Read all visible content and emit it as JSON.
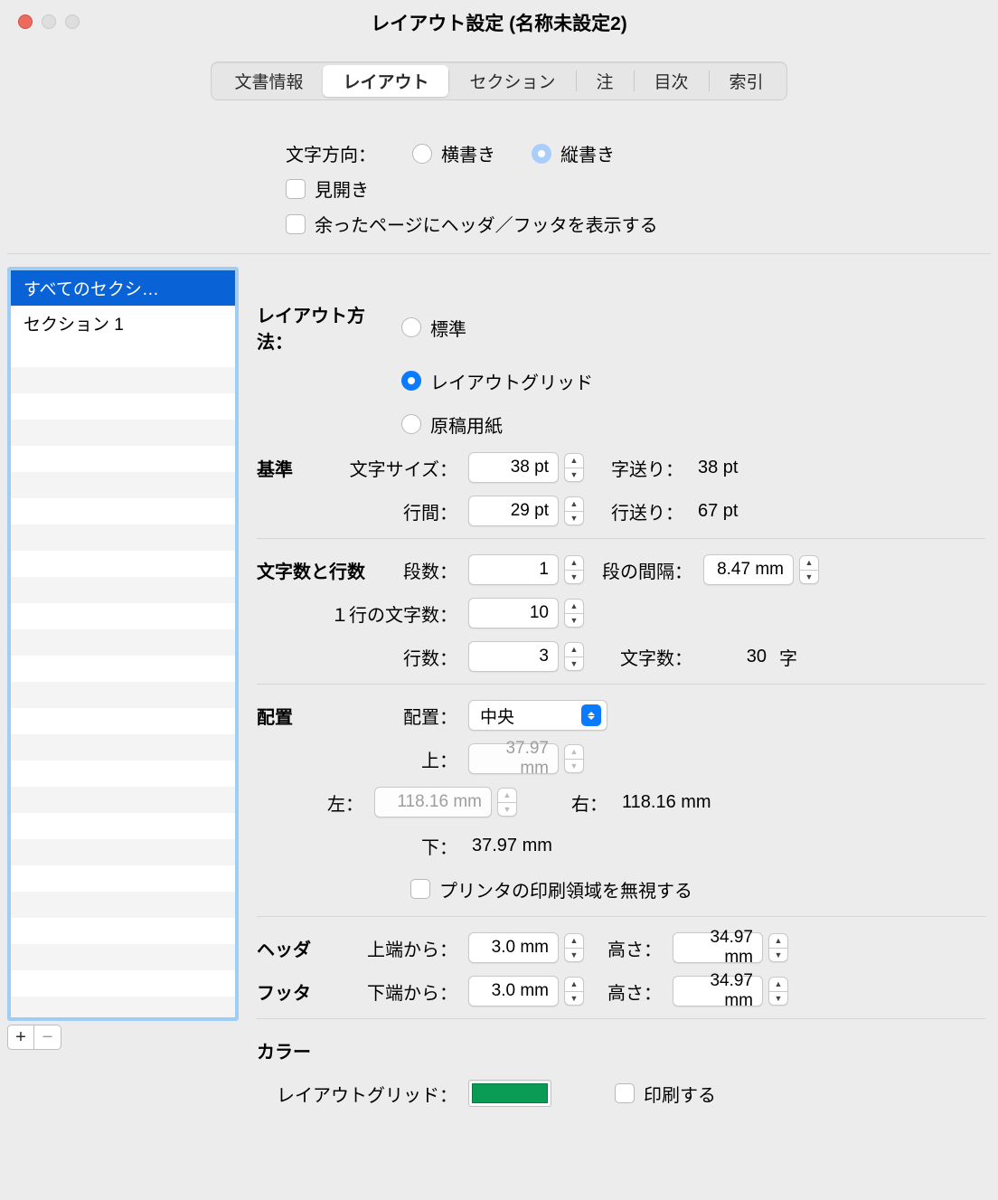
{
  "window": {
    "title": "レイアウト設定 (名称未設定2)"
  },
  "tabs": {
    "t0": "文書情報",
    "t1": "レイアウト",
    "t2": "セクション",
    "t3": "注",
    "t4": "目次",
    "t5": "索引"
  },
  "direction": {
    "label": "文字方向：",
    "opt_h": "横書き",
    "opt_v": "縦書き"
  },
  "spread": {
    "label": "見開き"
  },
  "extra_hf": {
    "label": "余ったページにヘッダ／フッタを表示する"
  },
  "sections": {
    "all": "すべてのセクシ…",
    "s1": "セクション 1"
  },
  "addremove": {
    "plus": "+",
    "minus": "−"
  },
  "layout_method": {
    "label": "レイアウト方法：",
    "r0": "標準",
    "r1": "レイアウトグリッド",
    "r2": "原稿用紙"
  },
  "base": {
    "head": "基準",
    "char_size_label": "文字サイズ：",
    "char_size": "38 pt",
    "char_feed_label": "字送り：",
    "char_feed": "38 pt",
    "line_gap_label": "行間：",
    "line_gap": "29 pt",
    "line_feed_label": "行送り：",
    "line_feed": "67 pt"
  },
  "chars_lines": {
    "head": "文字数と行数",
    "cols_label": "段数：",
    "cols": "1",
    "col_gap_label": "段の間隔：",
    "col_gap": "8.47 mm",
    "chars_per_line_label": "１行の文字数：",
    "chars_per_line": "10",
    "lines_label": "行数：",
    "lines": "3",
    "char_count_label": "文字数：",
    "char_count": "30",
    "char_unit": "字"
  },
  "position": {
    "head": "配置",
    "pos_label": "配置：",
    "pos_value": "中央",
    "top_label": "上：",
    "top": "37.97 mm",
    "left_label": "左：",
    "left": "118.16 mm",
    "right_label": "右：",
    "right": "118.16 mm",
    "bottom_label": "下：",
    "bottom": "37.97 mm",
    "ignore_printer": "プリンタの印刷領域を無視する"
  },
  "header": {
    "head": "ヘッダ",
    "from_label": "上端から：",
    "from": "3.0 mm",
    "height_label": "高さ：",
    "height": "34.97 mm"
  },
  "footer": {
    "head": "フッタ",
    "from_label": "下端から：",
    "from": "3.0 mm",
    "height_label": "高さ：",
    "height": "34.97 mm"
  },
  "color": {
    "head": "カラー",
    "grid_label": "レイアウトグリッド：",
    "print_label": "印刷する",
    "swatch": "#0a9c55"
  }
}
